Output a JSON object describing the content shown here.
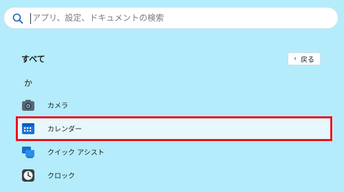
{
  "search": {
    "placeholder": "アプリ、設定、ドキュメントの検索",
    "value": ""
  },
  "section": {
    "title": "すべて",
    "back_label": "戻る"
  },
  "letter_header": "か",
  "apps": [
    {
      "label": "カメラ",
      "icon": "camera-icon"
    },
    {
      "label": "カレンダー",
      "icon": "calendar-icon",
      "highlighted": true
    },
    {
      "label": "クイック アシスト",
      "icon": "quick-assist-icon"
    },
    {
      "label": "クロック",
      "icon": "clock-icon"
    }
  ],
  "colors": {
    "background": "#b4ecfc",
    "highlight_border": "#e8121c",
    "accent": "#1a73d8"
  }
}
